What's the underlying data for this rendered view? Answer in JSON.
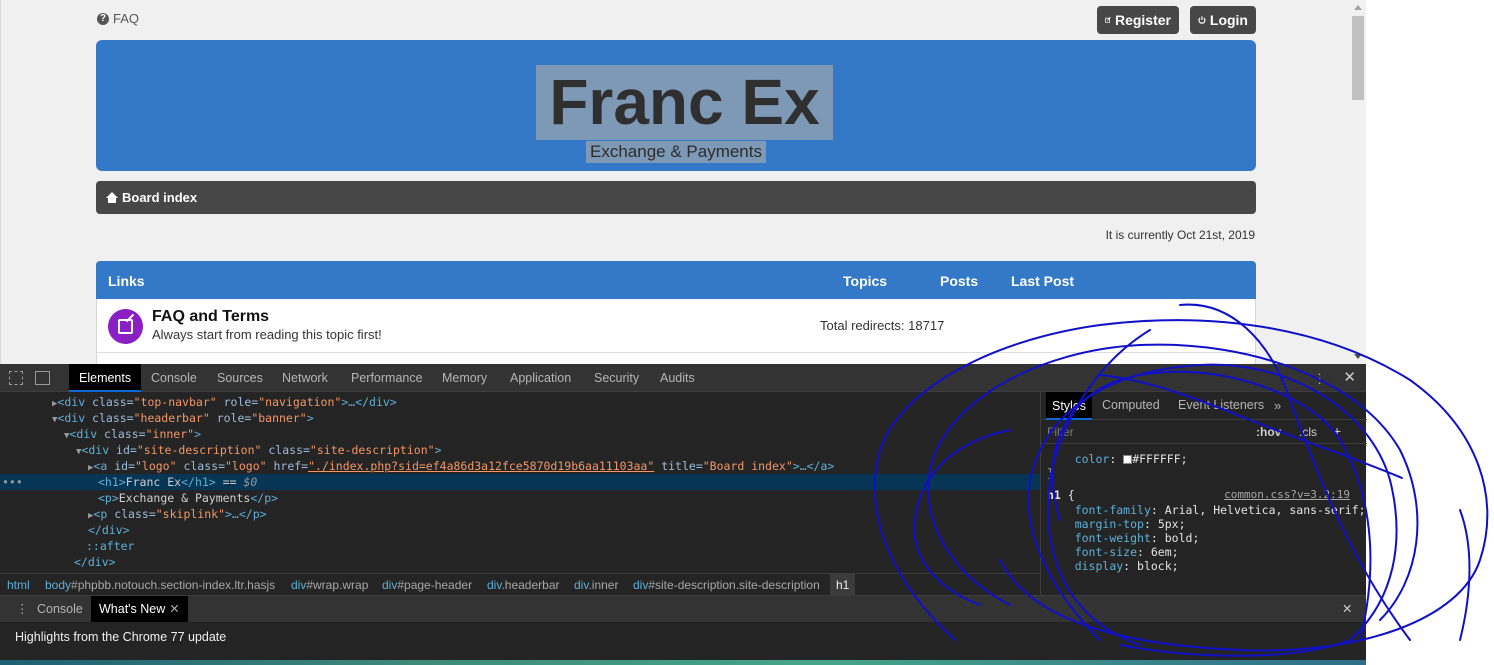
{
  "page": {
    "faq_label": "FAQ",
    "register_label": "Register",
    "login_label": "Login",
    "site_title": "Franc Ex",
    "site_description": "Exchange & Payments",
    "board_index_label": "Board index",
    "current_time": "It is currently Oct 21st, 2019",
    "forum_header": {
      "links": "Links",
      "topics": "Topics",
      "posts": "Posts",
      "last_post": "Last Post"
    },
    "forum": {
      "title": "FAQ and Terms",
      "description": "Always start from reading this topic first!",
      "redirects": "Total redirects: 18717"
    }
  },
  "devtools": {
    "tabs": [
      "Elements",
      "Console",
      "Sources",
      "Network",
      "Performance",
      "Memory",
      "Application",
      "Security",
      "Audits"
    ],
    "active_tab": "Elements",
    "dom": {
      "l1": {
        "tag1": "<div",
        "a1": " class=",
        "v1": "\"top-navbar\"",
        "a2": " role=",
        "v2": "\"navigation\"",
        "tail": ">…</div>"
      },
      "l2": {
        "tag1": "<div",
        "a1": " class=",
        "v1": "\"headerbar\"",
        "a2": " role=",
        "v2": "\"banner\"",
        "tail": ">"
      },
      "l3": {
        "tag1": "<div",
        "a1": " class=",
        "v1": "\"inner\"",
        "tail": ">"
      },
      "l4": {
        "tag1": "<div",
        "a1": " id=",
        "v1": "\"site-description\"",
        "a2": " class=",
        "v2": "\"site-description\"",
        "tail": ">"
      },
      "l5": {
        "tag1": "<a",
        "a1": " id=",
        "v1": "\"logo\"",
        "a2": " class=",
        "v2": "\"logo\"",
        "a3": " href=",
        "v3": "\"./index.php?sid=ef4a86d3a12fce5870d19b6aa11103aa\"",
        "a4": " title=",
        "v4": "\"Board index\"",
        "tail": ">…</a>"
      },
      "l6": {
        "open": "<h1>",
        "text": "Franc Ex",
        "close": "</h1>",
        "eq": " == ",
        "marker": "$0"
      },
      "l7": {
        "open": "<p>",
        "text": "Exchange & Payments",
        "close": "</p>"
      },
      "l8": {
        "tag1": "<p",
        "a1": " class=",
        "v1": "\"skiplink\"",
        "tail": ">…</p>"
      },
      "l9": {
        "text": "</div>"
      },
      "l10": {
        "text": "::after"
      },
      "l11": {
        "text": "</div>"
      }
    },
    "breadcrumb": [
      {
        "tag": "html",
        "rest": ""
      },
      {
        "tag": "body",
        "rest": "#phpbb.notouch.section-index.ltr.hasjs"
      },
      {
        "tag": "div",
        "rest": "#wrap.wrap"
      },
      {
        "tag": "div",
        "rest": "#page-header"
      },
      {
        "tag": "div",
        "rest": ".headerbar"
      },
      {
        "tag": "div",
        "rest": ".inner"
      },
      {
        "tag": "div",
        "rest": "#site-description.site-description"
      },
      {
        "tag": "h1",
        "rest": ""
      }
    ],
    "styles_tabs": [
      "Styles",
      "Computed",
      "Event Listeners"
    ],
    "filter_placeholder": "Filter",
    "hov": ":hov",
    "cls": ".cls",
    "color_rule": {
      "prop": "color",
      "value": "#FFFFFF"
    },
    "h1_rule": {
      "selector": "h1",
      "source": "common.css?v=3.2:19",
      "props": [
        {
          "name": "font-family",
          "value": "Arial, Helvetica, sans-serif"
        },
        {
          "name": "margin-top",
          "value": "5px"
        },
        {
          "name": "font-weight",
          "value": "bold"
        },
        {
          "name": "font-size",
          "value": "6em"
        },
        {
          "name": "display",
          "value": "block"
        }
      ]
    },
    "drawer_tabs": [
      "Console",
      "What's New"
    ],
    "drawer_message": "Highlights from the Chrome 77 update"
  },
  "colors": {
    "header_blue": "#3379c7",
    "navbar_dark": "#474747",
    "forum_icon_purple": "#8a1fc4",
    "scribble_blue": "#1010c8"
  }
}
